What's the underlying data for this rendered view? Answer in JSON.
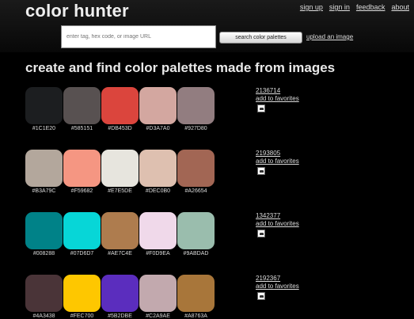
{
  "header": {
    "logo": "color hunter",
    "nav": [
      "sign up",
      "sign in",
      "feedback",
      "about"
    ],
    "search_placeholder": "enter tag, hex code, or image URL",
    "search_button": "search color palettes",
    "upload_link": "upload an image"
  },
  "main": {
    "heading": "create and find color palettes made from images",
    "favorites_label": "add to favorites",
    "palettes": [
      {
        "id": "2136714",
        "colors": [
          "#1C1E20",
          "#585151",
          "#DB453D",
          "#D3A7A0",
          "#927D80"
        ]
      },
      {
        "id": "2193805",
        "colors": [
          "#B3A79C",
          "#F59682",
          "#E7E5DE",
          "#DEC0B0",
          "#A26654"
        ]
      },
      {
        "id": "1342377",
        "colors": [
          "#008288",
          "#07D6D7",
          "#AE7C4E",
          "#F0D9EA",
          "#9ABDAD"
        ]
      },
      {
        "id": "2192367",
        "colors": [
          "#4A3438",
          "#FEC700",
          "#5B2DBE",
          "#C2A9AE",
          "#A8763A"
        ]
      }
    ]
  }
}
